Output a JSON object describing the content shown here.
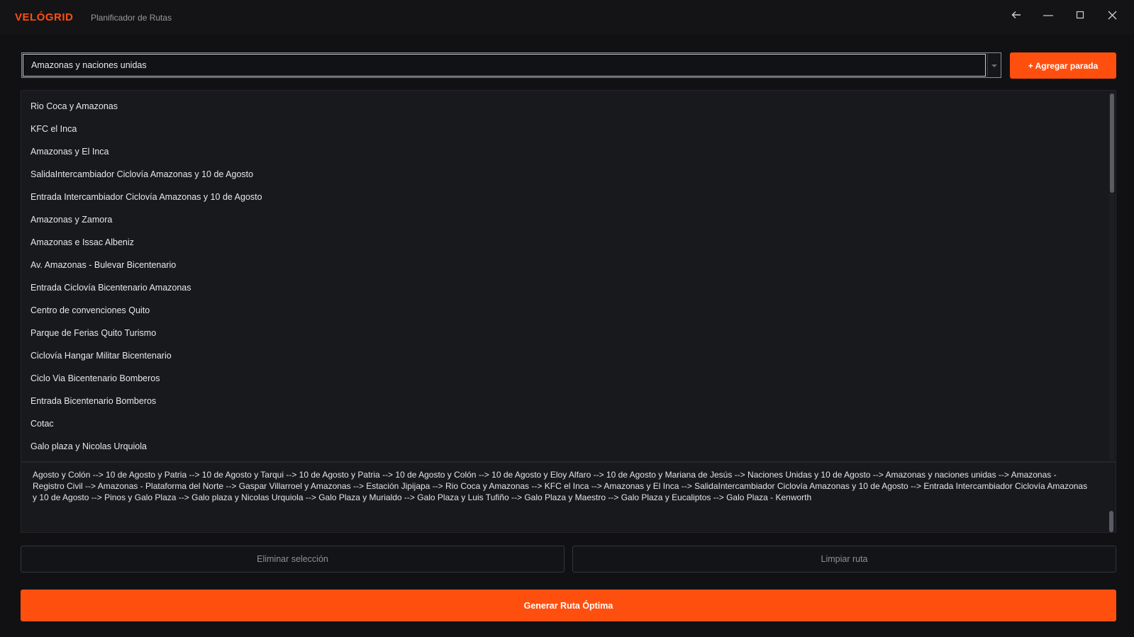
{
  "app": {
    "brand": "VELÓGRID",
    "subtitle": "Planificador de Rutas"
  },
  "window_controls": {
    "back_icon": "arrow-left-icon",
    "minimize_icon": "minimize-icon",
    "maximize_icon": "maximize-icon",
    "close_icon": "close-icon"
  },
  "search": {
    "value": "Amazonas y naciones unidas"
  },
  "add_button": {
    "label": "+ Agregar parada"
  },
  "stops": [
    "Rio Coca y Amazonas",
    "KFC el Inca",
    "Amazonas y El Inca",
    "SalidaIntercambiador Ciclovía Amazonas y 10 de Agosto",
    "Entrada Intercambiador Ciclovía Amazonas y 10 de Agosto",
    "Amazonas y Zamora",
    "Amazonas e Issac Albeniz",
    "Av. Amazonas - Bulevar Bicentenario",
    "Entrada Ciclovía Bicentenario Amazonas",
    "Centro de convenciones Quito",
    "Parque de Ferias Quito Turismo",
    "Ciclovía Hangar Militar Bicentenario",
    "Ciclo Via Bicentenario Bomberos",
    "Entrada Bicentenario Bomberos",
    "Cotac",
    "Galo plaza y Nicolas Urquiola"
  ],
  "route": {
    "text": "Agosto y Colón --> 10 de Agosto y Patria --> 10 de Agosto y Tarqui --> 10 de Agosto y Patria --> 10 de Agosto y Colón --> 10 de Agosto y Eloy Alfaro --> 10 de Agosto y Mariana de Jesús --> Naciones Unidas y 10 de Agosto --> Amazonas y naciones unidas --> Amazonas - Registro Civil --> Amazonas - Plataforma del Norte --> Gaspar Villarroel y Amazonas --> Estación Jipijapa --> Rio Coca y Amazonas --> KFC el Inca --> Amazonas y El Inca --> SalidaIntercambiador Ciclovía Amazonas y 10 de Agosto --> Entrada Intercambiador Ciclovía Amazonas y 10 de Agosto --> Pinos y Galo Plaza --> Galo plaza y Nicolas Urquiola --> Galo Plaza y Murialdo --> Galo Plaza y Luis Tufiño --> Galo Plaza y Maestro --> Galo Plaza y Eucaliptos --> Galo Plaza - Kenworth"
  },
  "actions": {
    "remove_label": "Eliminar selección",
    "clear_label": "Limpiar ruta",
    "generate_label": "Generar Ruta Óptima"
  },
  "colors": {
    "accent": "#ff4f0f",
    "background": "#111114",
    "panel": "#18191d"
  }
}
